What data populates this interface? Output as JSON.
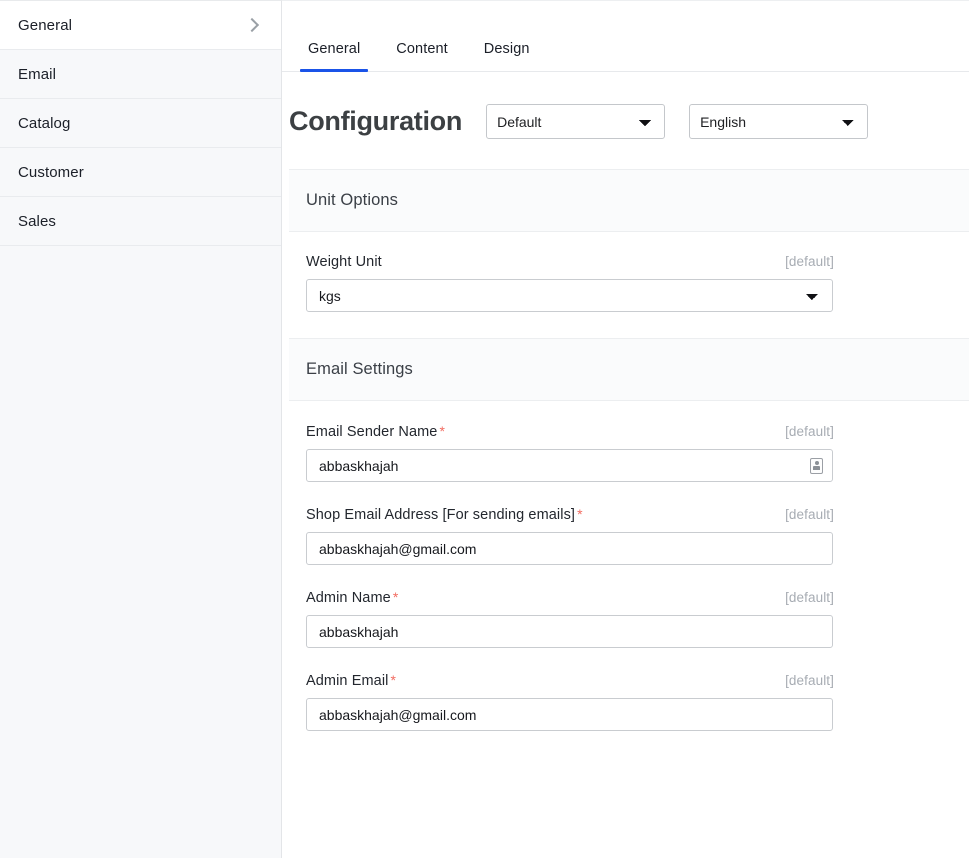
{
  "sidebar": {
    "items": [
      {
        "label": "General",
        "active": true,
        "chevron": "chevron-right-icon"
      },
      {
        "label": "Email",
        "active": false
      },
      {
        "label": "Catalog",
        "active": false
      },
      {
        "label": "Customer",
        "active": false
      },
      {
        "label": "Sales",
        "active": false
      }
    ]
  },
  "tabs": [
    {
      "label": "General",
      "active": true
    },
    {
      "label": "Content",
      "active": false
    },
    {
      "label": "Design",
      "active": false
    }
  ],
  "header": {
    "title": "Configuration",
    "store_scope": {
      "value": "Default",
      "options": [
        "Default"
      ]
    },
    "language": {
      "value": "English",
      "options": [
        "English"
      ]
    }
  },
  "sections": [
    {
      "title": "Unit Options",
      "fields": [
        {
          "label": "Weight Unit",
          "required": false,
          "scope": "[default]",
          "control": "select",
          "value": "kgs",
          "options": [
            "kgs"
          ]
        }
      ]
    },
    {
      "title": "Email Settings",
      "fields": [
        {
          "label": "Email Sender Name",
          "required": true,
          "scope": "[default]",
          "control": "text",
          "value": "abbaskhajah",
          "placeholder": "",
          "icon": "autofill-contact-icon"
        },
        {
          "label": "Shop Email Address [For sending emails]",
          "required": true,
          "scope": "[default]",
          "control": "text",
          "value": "abbaskhajah@gmail.com",
          "placeholder": ""
        },
        {
          "label": "Admin Name",
          "required": true,
          "scope": "[default]",
          "control": "text",
          "value": "abbaskhajah",
          "placeholder": ""
        },
        {
          "label": "Admin Email",
          "required": true,
          "scope": "[default]",
          "control": "text",
          "value": "abbaskhajah@gmail.com",
          "placeholder": ""
        }
      ]
    }
  ],
  "colors": {
    "accent": "#1a53e8",
    "required_asterisk": "#f26b60",
    "sidebar_bg": "#f7f8fa",
    "section_header_bg": "#fafbfc",
    "scope_text": "#a7acb3"
  }
}
